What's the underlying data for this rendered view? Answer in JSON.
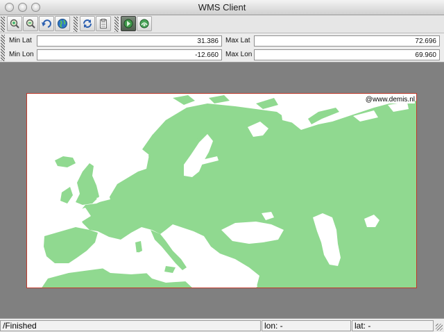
{
  "window": {
    "title": "WMS Client"
  },
  "toolbar": {
    "buttons": [
      {
        "name": "zoom-in-icon"
      },
      {
        "name": "zoom-out-icon"
      },
      {
        "name": "undo-icon"
      },
      {
        "name": "globe-icon"
      },
      {
        "name": "refresh-icon"
      },
      {
        "name": "clipboard-icon"
      },
      {
        "name": "pan-tool-icon",
        "pressed": true
      },
      {
        "name": "info-tool-icon"
      }
    ]
  },
  "bounds": {
    "min_lat_label": "Min Lat",
    "min_lat_value": "31.386",
    "max_lat_label": "Max Lat",
    "max_lat_value": "72.696",
    "min_lon_label": "Min Lon",
    "min_lon_value": "-12.660",
    "max_lon_label": "Max Lon",
    "max_lon_value": "69.960"
  },
  "map": {
    "credit": "@www.demis.nl",
    "land_color": "#90d990",
    "water_color": "#ffffff",
    "border_color": "#c0392b"
  },
  "status": {
    "message": "/Finished",
    "lon": "lon: -",
    "lat": "lat: -"
  }
}
